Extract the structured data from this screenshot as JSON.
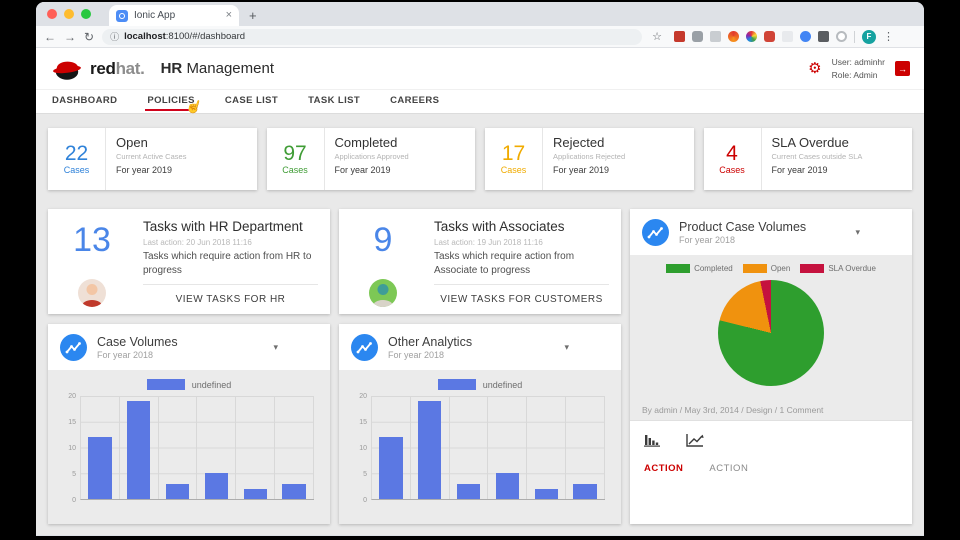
{
  "browser": {
    "tab_title": "Ionic App",
    "close_tab": "×",
    "new_tab": "+",
    "url_host": "localhost",
    "url_rest": ":8100/#/dashboard",
    "profile_initial": "F",
    "traffic_light_colors": [
      "#ff5f57",
      "#febc2e",
      "#28c840"
    ],
    "extension_icons": [
      "extension-red-badge",
      "extension-bell",
      "extension-gray",
      "extension-opera",
      "extension-color-wheel",
      "extension-adblock",
      "extension-pale",
      "extension-blue-circle",
      "extension-dark",
      "extension-ring"
    ]
  },
  "header": {
    "brand_red": "red",
    "brand_hat": "hat.",
    "app_title": "HR Management",
    "user_line": "User: adminhr",
    "role_line": "Role: Admin"
  },
  "nav": {
    "items": [
      {
        "label": "DASHBOARD",
        "active": false
      },
      {
        "label": "POLICIES",
        "active": true
      },
      {
        "label": "CASE LIST",
        "active": false
      },
      {
        "label": "TASK LIST",
        "active": false
      },
      {
        "label": "CAREERS",
        "active": false
      }
    ]
  },
  "stat_cards": [
    {
      "value": "22",
      "unit": "Cases",
      "color": "#2f82d9",
      "title": "Open",
      "subtitle": "Current Active Cases",
      "period": "For year 2019"
    },
    {
      "value": "97",
      "unit": "Cases",
      "color": "#3f9c35",
      "title": "Completed",
      "subtitle": "Applications Approved",
      "period": "For year 2019"
    },
    {
      "value": "17",
      "unit": "Cases",
      "color": "#f0ab00",
      "title": "Rejected",
      "subtitle": "Applications Rejected",
      "period": "For year 2019"
    },
    {
      "value": "4",
      "unit": "Cases",
      "color": "#cc0000",
      "title": "SLA Overdue",
      "subtitle": "Current Cases outside SLA",
      "period": "For year 2019"
    }
  ],
  "task_cards": [
    {
      "count": "13",
      "title": "Tasks with HR Department",
      "last_action": "Last action: 20 Jun 2018 11:16",
      "description": "Tasks which require action from HR to progress",
      "button": "VIEW TASKS FOR HR"
    },
    {
      "count": "9",
      "title": "Tasks with Associates",
      "last_action": "Last action: 19 Jun 2018 11:16",
      "description": "Tasks which require action from Associate to progress",
      "button": "VIEW TASKS FOR CUSTOMERS"
    }
  ],
  "chart_cards": [
    {
      "title": "Case Volumes",
      "subtitle": "For year 2018",
      "legend": "undefined"
    },
    {
      "title": "Other Analytics",
      "subtitle": "For year 2018",
      "legend": "undefined"
    }
  ],
  "product_card": {
    "title": "Product Case Volumes",
    "subtitle": "For year 2018",
    "byline": "By admin / May 3rd, 2014 / Design / 1 Comment",
    "action_primary": "ACTION",
    "action_secondary": "ACTION"
  },
  "chart_data": [
    {
      "type": "bar",
      "title": "Case Volumes",
      "subtitle": "For year 2018",
      "legend": [
        "undefined"
      ],
      "categories": [
        "",
        "",
        "",
        "",
        "",
        ""
      ],
      "values": [
        12,
        19,
        3,
        5,
        2,
        3
      ],
      "ylim": [
        0,
        20
      ],
      "yticks": [
        0,
        5,
        10,
        15,
        20
      ],
      "bar_color": "#5b78e3",
      "grid": true,
      "xlabel": "",
      "ylabel": ""
    },
    {
      "type": "bar",
      "title": "Other Analytics",
      "subtitle": "For year 2018",
      "legend": [
        "undefined"
      ],
      "categories": [
        "",
        "",
        "",
        "",
        "",
        ""
      ],
      "values": [
        12,
        19,
        3,
        5,
        2,
        3
      ],
      "ylim": [
        0,
        20
      ],
      "yticks": [
        0,
        5,
        10,
        15,
        20
      ],
      "bar_color": "#5b78e3",
      "grid": true,
      "xlabel": "",
      "ylabel": ""
    },
    {
      "type": "pie",
      "title": "Product Case Volumes",
      "subtitle": "For year 2018",
      "labels": [
        "Completed",
        "Open",
        "SLA Overdue"
      ],
      "values": [
        97,
        22,
        4
      ],
      "colors": [
        "#2e9e2e",
        "#f0920e",
        "#c5123e"
      ],
      "legend_position": "top"
    }
  ]
}
